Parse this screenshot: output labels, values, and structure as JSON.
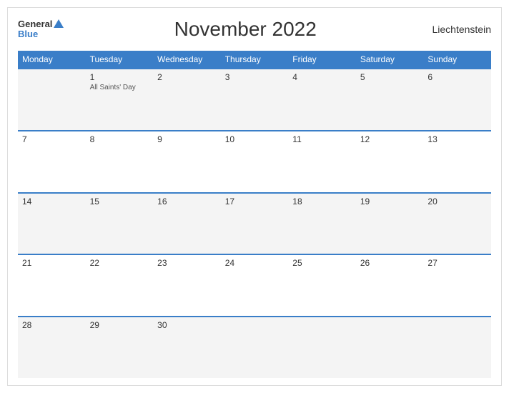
{
  "header": {
    "logo_general": "General",
    "logo_blue": "Blue",
    "title": "November 2022",
    "country": "Liechtenstein"
  },
  "days_of_week": [
    "Monday",
    "Tuesday",
    "Wednesday",
    "Thursday",
    "Friday",
    "Saturday",
    "Sunday"
  ],
  "weeks": [
    [
      {
        "day": "",
        "holiday": ""
      },
      {
        "day": "1",
        "holiday": "All Saints' Day"
      },
      {
        "day": "2",
        "holiday": ""
      },
      {
        "day": "3",
        "holiday": ""
      },
      {
        "day": "4",
        "holiday": ""
      },
      {
        "day": "5",
        "holiday": ""
      },
      {
        "day": "6",
        "holiday": ""
      }
    ],
    [
      {
        "day": "7",
        "holiday": ""
      },
      {
        "day": "8",
        "holiday": ""
      },
      {
        "day": "9",
        "holiday": ""
      },
      {
        "day": "10",
        "holiday": ""
      },
      {
        "day": "11",
        "holiday": ""
      },
      {
        "day": "12",
        "holiday": ""
      },
      {
        "day": "13",
        "holiday": ""
      }
    ],
    [
      {
        "day": "14",
        "holiday": ""
      },
      {
        "day": "15",
        "holiday": ""
      },
      {
        "day": "16",
        "holiday": ""
      },
      {
        "day": "17",
        "holiday": ""
      },
      {
        "day": "18",
        "holiday": ""
      },
      {
        "day": "19",
        "holiday": ""
      },
      {
        "day": "20",
        "holiday": ""
      }
    ],
    [
      {
        "day": "21",
        "holiday": ""
      },
      {
        "day": "22",
        "holiday": ""
      },
      {
        "day": "23",
        "holiday": ""
      },
      {
        "day": "24",
        "holiday": ""
      },
      {
        "day": "25",
        "holiday": ""
      },
      {
        "day": "26",
        "holiday": ""
      },
      {
        "day": "27",
        "holiday": ""
      }
    ],
    [
      {
        "day": "28",
        "holiday": ""
      },
      {
        "day": "29",
        "holiday": ""
      },
      {
        "day": "30",
        "holiday": ""
      },
      {
        "day": "",
        "holiday": ""
      },
      {
        "day": "",
        "holiday": ""
      },
      {
        "day": "",
        "holiday": ""
      },
      {
        "day": "",
        "holiday": ""
      }
    ]
  ],
  "colors": {
    "header_bg": "#3a7ec8",
    "accent": "#3a7ec8"
  }
}
